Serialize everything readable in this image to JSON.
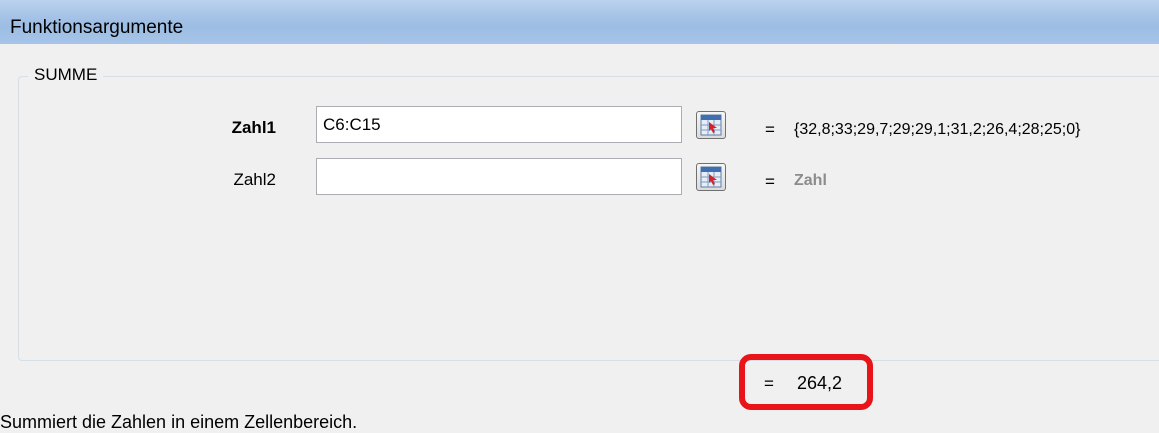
{
  "window": {
    "title": "Funktionsargumente"
  },
  "group": {
    "legend": "SUMME"
  },
  "arguments": [
    {
      "label": "Zahl1",
      "value": "C6:C15",
      "result": "{32,8;33;29,7;29;29,1;31,2;26,4;28;25;0}",
      "equals": "="
    },
    {
      "label": "Zahl2",
      "value": "",
      "result": "Zahl",
      "equals": "="
    }
  ],
  "result": {
    "equals": "=",
    "value": "264,2"
  },
  "description": "Summiert die Zahlen in einem Zellenbereich.",
  "colors": {
    "highlight": "#e8141a",
    "titlebar": "#a9c5e8"
  }
}
